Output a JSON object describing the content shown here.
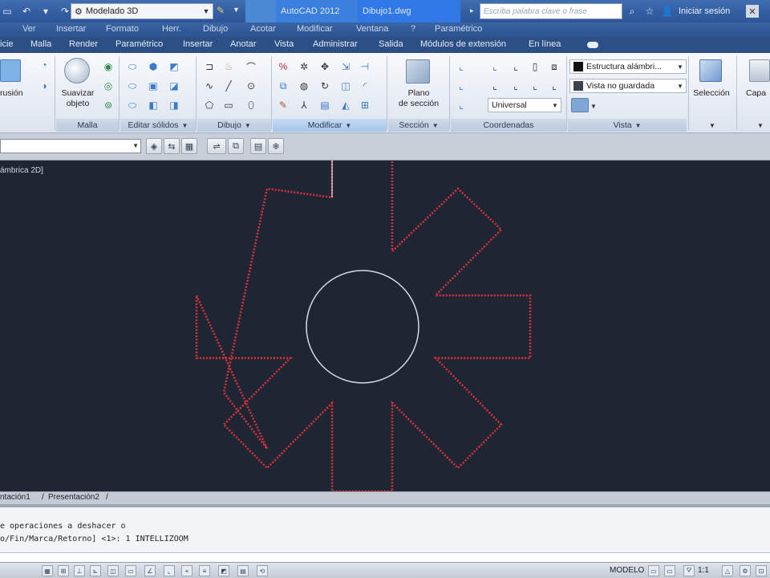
{
  "title_bar": {
    "workspace": "Modelado 3D",
    "app_title": "AutoCAD 2012",
    "document": "Dibujo1.dwg",
    "search_placeholder": "Escriba palabra clave o frase",
    "sign_in": "Iniciar sesión"
  },
  "menu": {
    "items": [
      "Ver",
      "Insertar",
      "Formato",
      "Herr.",
      "Dibujo",
      "Acotar",
      "Modificar",
      "Ventana",
      "?",
      "Paramétrico"
    ]
  },
  "ribbon_tabs": {
    "items": [
      "icie",
      "Malla",
      "Render",
      "Paramétrico",
      "Insertar",
      "Anotar",
      "Vista",
      "Administrar",
      "Salida",
      "Módulos de extensión",
      "En línea"
    ]
  },
  "ribbon": {
    "panels": [
      {
        "label": "Malla"
      },
      {
        "label": "Editar sólidos"
      },
      {
        "label": "Dibujo"
      },
      {
        "label": "Modificar"
      },
      {
        "label": "Sección"
      },
      {
        "label": "Coordenadas"
      },
      {
        "label": "Vista"
      }
    ],
    "big_buttons": {
      "extrusion": "rusión",
      "smooth_line1": "Suavizar",
      "smooth_line2": "objeto",
      "plane_line1": "Plano",
      "plane_line2": "de sección",
      "selection": "Selección",
      "layers": "Capa"
    },
    "selects": {
      "visual_style": "Estructura alámbri...",
      "view_state": "Vista no guardada",
      "ucs": "Universal"
    }
  },
  "viewport": {
    "label": "ámbrica 2D]"
  },
  "layout_tabs": {
    "items": [
      "ntación1",
      "Presentación2"
    ]
  },
  "command": {
    "line1": "e operaciones a deshacer o",
    "line2": "o/Fin/Marca/Retorno] <1>: 1 INTELLIZOOM"
  },
  "status": {
    "model": "MODELO",
    "scale": "1:1"
  },
  "colors": {
    "title_bar": "#2f5b9e",
    "viewport_bg": "#1f2633",
    "shape_stroke": "#e0303a",
    "circle_stroke": "#d6dbe2"
  }
}
